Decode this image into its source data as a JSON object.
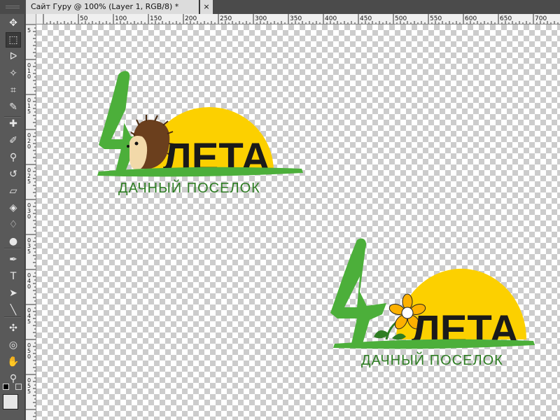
{
  "document": {
    "tab_title": "Сайт Гуру @ 100% (Layer 1, RGB/8) *",
    "close_glyph": "×"
  },
  "ruler": {
    "h_labels": [
      "50",
      "100",
      "150",
      "200",
      "250",
      "300",
      "350",
      "400",
      "450",
      "500",
      "550",
      "600",
      "650",
      "700"
    ],
    "v_labels": [
      "5",
      "0",
      "1",
      "0",
      "0",
      "1",
      "5",
      "0",
      "2",
      "0",
      "0",
      "2",
      "5",
      "0",
      "3",
      "0",
      "0",
      "3",
      "5",
      "0",
      "4",
      "0",
      "0",
      "4",
      "5",
      "0",
      "5",
      "0",
      "0",
      "5",
      "5",
      "0"
    ]
  },
  "toolbox": {
    "tools": [
      {
        "name": "move-tool-icon",
        "glyph": "✥"
      },
      {
        "name": "marquee-tool-icon",
        "glyph": "⬚"
      },
      {
        "name": "lasso-tool-icon",
        "glyph": "ᐅ"
      },
      {
        "name": "magic-wand-icon",
        "glyph": "✧"
      },
      {
        "name": "crop-tool-icon",
        "glyph": "⌗"
      },
      {
        "name": "eyedropper-icon",
        "glyph": "✎"
      },
      {
        "name": "healing-brush-icon",
        "glyph": "✚"
      },
      {
        "name": "brush-tool-icon",
        "glyph": "✐"
      },
      {
        "name": "clone-stamp-icon",
        "glyph": "⚲"
      },
      {
        "name": "history-brush-icon",
        "glyph": "↺"
      },
      {
        "name": "eraser-icon",
        "glyph": "▱"
      },
      {
        "name": "paint-bucket-icon",
        "glyph": "◈"
      },
      {
        "name": "blur-tool-icon",
        "glyph": "♢"
      },
      {
        "name": "dodge-tool-icon",
        "glyph": "●"
      },
      {
        "name": "pen-tool-icon",
        "glyph": "✒"
      },
      {
        "name": "type-tool-icon",
        "glyph": "T"
      },
      {
        "name": "path-select-icon",
        "glyph": "➤"
      },
      {
        "name": "line-tool-icon",
        "glyph": "╲"
      },
      {
        "name": "3d-rotate-icon",
        "glyph": "✣"
      },
      {
        "name": "3d-orbit-icon",
        "glyph": "◎"
      },
      {
        "name": "hand-tool-icon",
        "glyph": "✋"
      },
      {
        "name": "zoom-tool-icon",
        "glyph": "⚲"
      }
    ]
  },
  "logos": [
    {
      "id": "hedgehog",
      "numeral": "4",
      "word": "ЛЕТА",
      "subtitle": "ДАЧНЫЙ ПОСЕЛОК"
    },
    {
      "id": "flower",
      "numeral": "4",
      "word": "ЛЕТА",
      "subtitle": "ДАЧНЫЙ ПОСЕЛОК"
    }
  ],
  "colors": {
    "green": "#4caf3a",
    "dark_green": "#2e7d23",
    "sun": "#fcd000",
    "text_dark": "#1a1a1a"
  }
}
